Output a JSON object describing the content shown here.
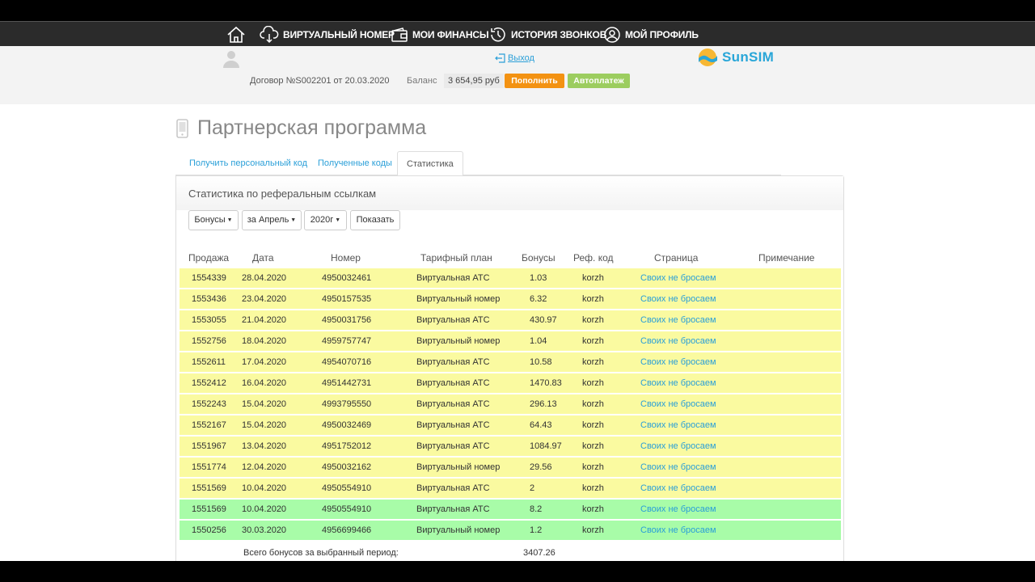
{
  "nav": {
    "home_icon": "home-icon",
    "items": [
      {
        "label": "ВИРТУАЛЬНЫЙ НОМЕР",
        "icon": "cloud-phone-icon"
      },
      {
        "label": "МОИ ФИНАНСЫ",
        "icon": "wallet-icon"
      },
      {
        "label": "ИСТОРИЯ ЗВОНКОВ",
        "icon": "clock-icon"
      },
      {
        "label": "МОЙ ПРОФИЛЬ",
        "icon": "user-icon"
      }
    ]
  },
  "header": {
    "logout": "Выход",
    "logo": "SunSIM",
    "contract": "Договор №S002201 от 20.03.2020",
    "balance_label": "Баланс",
    "balance_value": "3 654,95 руб",
    "topup_button": "Пополнить",
    "autopay_button": "Автоплатеж"
  },
  "page": {
    "title": "Партнерская программа",
    "tabs": [
      "Получить персональный код",
      "Полученные коды",
      "Статистика"
    ],
    "active_tab": "Статистика"
  },
  "panel": {
    "title": "Статистика по реферальным ссылкам",
    "filters": {
      "type": "Бонусы",
      "month": "за Апрель",
      "year": "2020г",
      "show_button": "Показать"
    },
    "columns": [
      "Продажа",
      "Дата",
      "Номер",
      "Тарифный план",
      "Бонусы",
      "Реф. код",
      "Страница",
      "Примечание"
    ],
    "rows": [
      {
        "sale": "1554339",
        "date": "28.04.2020",
        "number": "4950032461",
        "plan": "Виртуальная АТС",
        "bonus": "1.03",
        "ref": "korzh",
        "page": "Своих не бросаем",
        "status": "yellow"
      },
      {
        "sale": "1553436",
        "date": "23.04.2020",
        "number": "4950157535",
        "plan": "Виртуальный номер",
        "bonus": "6.32",
        "ref": "korzh",
        "page": "Своих не бросаем",
        "status": "yellow"
      },
      {
        "sale": "1553055",
        "date": "21.04.2020",
        "number": "4950031756",
        "plan": "Виртуальная АТС",
        "bonus": "430.97",
        "ref": "korzh",
        "page": "Своих не бросаем",
        "status": "yellow"
      },
      {
        "sale": "1552756",
        "date": "18.04.2020",
        "number": "4959757747",
        "plan": "Виртуальный номер",
        "bonus": "1.04",
        "ref": "korzh",
        "page": "Своих не бросаем",
        "status": "yellow"
      },
      {
        "sale": "1552611",
        "date": "17.04.2020",
        "number": "4954070716",
        "plan": "Виртуальная АТС",
        "bonus": "10.58",
        "ref": "korzh",
        "page": "Своих не бросаем",
        "status": "yellow"
      },
      {
        "sale": "1552412",
        "date": "16.04.2020",
        "number": "4951442731",
        "plan": "Виртуальная АТС",
        "bonus": "1470.83",
        "ref": "korzh",
        "page": "Своих не бросаем",
        "status": "yellow"
      },
      {
        "sale": "1552243",
        "date": "15.04.2020",
        "number": "4993795550",
        "plan": "Виртуальная АТС",
        "bonus": "296.13",
        "ref": "korzh",
        "page": "Своих не бросаем",
        "status": "yellow"
      },
      {
        "sale": "1552167",
        "date": "15.04.2020",
        "number": "4950032469",
        "plan": "Виртуальная АТС",
        "bonus": "64.43",
        "ref": "korzh",
        "page": "Своих не бросаем",
        "status": "yellow"
      },
      {
        "sale": "1551967",
        "date": "13.04.2020",
        "number": "4951752012",
        "plan": "Виртуальная АТС",
        "bonus": "1084.97",
        "ref": "korzh",
        "page": "Своих не бросаем",
        "status": "yellow"
      },
      {
        "sale": "1551774",
        "date": "12.04.2020",
        "number": "4950032162",
        "plan": "Виртуальный номер",
        "bonus": "29.56",
        "ref": "korzh",
        "page": "Своих не бросаем",
        "status": "yellow"
      },
      {
        "sale": "1551569",
        "date": "10.04.2020",
        "number": "4950554910",
        "plan": "Виртуальная АТС",
        "bonus": "2",
        "ref": "korzh",
        "page": "Своих не бросаем",
        "status": "yellow"
      },
      {
        "sale": "1551569",
        "date": "10.04.2020",
        "number": "4950554910",
        "plan": "Виртуальная АТС",
        "bonus": "8.2",
        "ref": "korzh",
        "page": "Своих не бросаем",
        "status": "green"
      },
      {
        "sale": "1550256",
        "date": "30.03.2020",
        "number": "4956699466",
        "plan": "Виртуальный номер",
        "bonus": "1.2",
        "ref": "korzh",
        "page": "Своих не бросаем",
        "status": "green"
      }
    ],
    "total_label": "Всего бонусов за выбранный период:",
    "total_value": "3407.26"
  },
  "colors": {
    "accent": "#2a9fd8",
    "topup": "#f39212",
    "autopay": "#9ccd5f",
    "row_yellow": "#fafaa0",
    "row_green": "#a8fca8",
    "navbar": "#2b2b2b"
  }
}
